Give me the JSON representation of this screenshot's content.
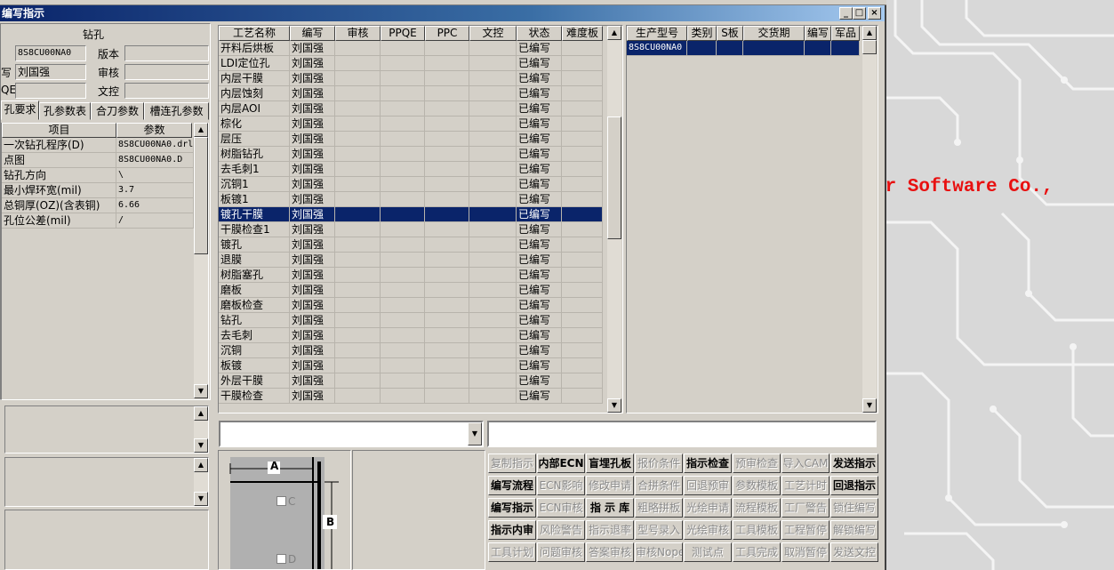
{
  "window": {
    "title": "编写指示",
    "min_glyph": "_",
    "max_glyph": "□",
    "close_glyph": "×"
  },
  "background_text": "er Software Co.,",
  "left_panel": {
    "title": "钻孔",
    "field_values": [
      "8S8CU00NA0",
      "刘国强",
      ""
    ],
    "field_labels_left": [
      "",
      "写",
      "QE"
    ],
    "field_labels_right": [
      "版本",
      "审核",
      "文控"
    ],
    "tabs": [
      "孔要求",
      "孔参数表",
      "合刀参数",
      "槽连孔参数"
    ],
    "param_columns": [
      "项目",
      "参数"
    ],
    "params": [
      {
        "item": "一次钻孔程序(D)",
        "value": "8S8CU00NA0.drl"
      },
      {
        "item": "点图",
        "value": "8S8CU00NA0.D"
      },
      {
        "item": "钻孔方向",
        "value": "\\"
      },
      {
        "item": "最小焊环宽(mil)",
        "value": "3.7"
      },
      {
        "item": "总铜厚(OZ)(含表铜)",
        "value": "6.66"
      },
      {
        "item": "孔位公差(mil)",
        "value": "/"
      }
    ]
  },
  "process_table": {
    "columns": [
      "工艺名称",
      "编写",
      "审核",
      "PPQE",
      "PPC",
      "文控",
      "状态",
      "难度板"
    ],
    "selected_index": 11,
    "rows": [
      {
        "name": "开料后烘板",
        "writer": "刘国强",
        "status": "已编写"
      },
      {
        "name": "LDI定位孔",
        "writer": "刘国强",
        "status": "已编写"
      },
      {
        "name": "内层干膜",
        "writer": "刘国强",
        "status": "已编写"
      },
      {
        "name": "内层蚀刻",
        "writer": "刘国强",
        "status": "已编写"
      },
      {
        "name": "内层AOI",
        "writer": "刘国强",
        "status": "已编写"
      },
      {
        "name": "棕化",
        "writer": "刘国强",
        "status": "已编写"
      },
      {
        "name": "层压",
        "writer": "刘国强",
        "status": "已编写"
      },
      {
        "name": "树脂钻孔",
        "writer": "刘国强",
        "status": "已编写"
      },
      {
        "name": "去毛刺1",
        "writer": "刘国强",
        "status": "已编写"
      },
      {
        "name": "沉铜1",
        "writer": "刘国强",
        "status": "已编写"
      },
      {
        "name": "板镀1",
        "writer": "刘国强",
        "status": "已编写"
      },
      {
        "name": "镀孔干膜",
        "writer": "刘国强",
        "status": "已编写"
      },
      {
        "name": "干膜检查1",
        "writer": "刘国强",
        "status": "已编写"
      },
      {
        "name": "镀孔",
        "writer": "刘国强",
        "status": "已编写"
      },
      {
        "name": "退膜",
        "writer": "刘国强",
        "status": "已编写"
      },
      {
        "name": "树脂塞孔",
        "writer": "刘国强",
        "status": "已编写"
      },
      {
        "name": "磨板",
        "writer": "刘国强",
        "status": "已编写"
      },
      {
        "name": "磨板检查",
        "writer": "刘国强",
        "status": "已编写"
      },
      {
        "name": "钻孔",
        "writer": "刘国强",
        "status": "已编写"
      },
      {
        "name": "去毛刺",
        "writer": "刘国强",
        "status": "已编写"
      },
      {
        "name": "沉铜",
        "writer": "刘国强",
        "status": "已编写"
      },
      {
        "name": "板镀",
        "writer": "刘国强",
        "status": "已编写"
      },
      {
        "name": "外层干膜",
        "writer": "刘国强",
        "status": "已编写"
      },
      {
        "name": "干膜检查",
        "writer": "刘国强",
        "status": "已编写"
      }
    ]
  },
  "model_table": {
    "columns": [
      "生产型号",
      "类别",
      "S板",
      "交货期",
      "编写",
      "军品"
    ],
    "rows": [
      {
        "model": "8S8CU00NA0"
      }
    ]
  },
  "diagram": {
    "label_a": "A",
    "label_b": "B",
    "label_c": "C",
    "label_d": "D"
  },
  "buttons": [
    [
      {
        "label": "复制指示",
        "enabled": false
      },
      {
        "label": "内部ECN",
        "enabled": true
      },
      {
        "label": "盲埋孔板",
        "enabled": true
      },
      {
        "label": "报价条件",
        "enabled": false
      },
      {
        "label": "指示检查",
        "enabled": true
      },
      {
        "label": "预审检查",
        "enabled": false
      },
      {
        "label": "导入CAM",
        "enabled": false
      },
      {
        "label": "发送指示",
        "enabled": true
      }
    ],
    [
      {
        "label": "编写流程",
        "enabled": true
      },
      {
        "label": "ECN影响",
        "enabled": false
      },
      {
        "label": "修改申请",
        "enabled": false
      },
      {
        "label": "合拼条件",
        "enabled": false
      },
      {
        "label": "回退预审",
        "enabled": false
      },
      {
        "label": "参数模板",
        "enabled": false
      },
      {
        "label": "工艺计时",
        "enabled": false
      },
      {
        "label": "回退指示",
        "enabled": true
      }
    ],
    [
      {
        "label": "编写指示",
        "enabled": true
      },
      {
        "label": "ECN审核",
        "enabled": false
      },
      {
        "label": "指 示 库",
        "enabled": true
      },
      {
        "label": "粗略拼板",
        "enabled": false
      },
      {
        "label": "光绘申请",
        "enabled": false
      },
      {
        "label": "流程模板",
        "enabled": false
      },
      {
        "label": "工厂警告",
        "enabled": false
      },
      {
        "label": "锁住编写",
        "enabled": false
      }
    ],
    [
      {
        "label": "指示内审",
        "enabled": true
      },
      {
        "label": "风险警告",
        "enabled": false
      },
      {
        "label": "指示退率",
        "enabled": false
      },
      {
        "label": "型号录入",
        "enabled": false
      },
      {
        "label": "光绘审核",
        "enabled": false
      },
      {
        "label": "工具模板",
        "enabled": false
      },
      {
        "label": "工程暂停",
        "enabled": false
      },
      {
        "label": "解锁编写",
        "enabled": false
      }
    ],
    [
      {
        "label": "工具计划",
        "enabled": false
      },
      {
        "label": "问题审核",
        "enabled": false
      },
      {
        "label": "答案审核",
        "enabled": false
      },
      {
        "label": "审核Nope",
        "enabled": false
      },
      {
        "label": "测试点",
        "enabled": false
      },
      {
        "label": "工具完成",
        "enabled": false
      },
      {
        "label": "取消暂停",
        "enabled": false
      },
      {
        "label": "发送文控",
        "enabled": false
      }
    ]
  ],
  "combo": {
    "value": ""
  },
  "memo": {
    "value": ""
  }
}
